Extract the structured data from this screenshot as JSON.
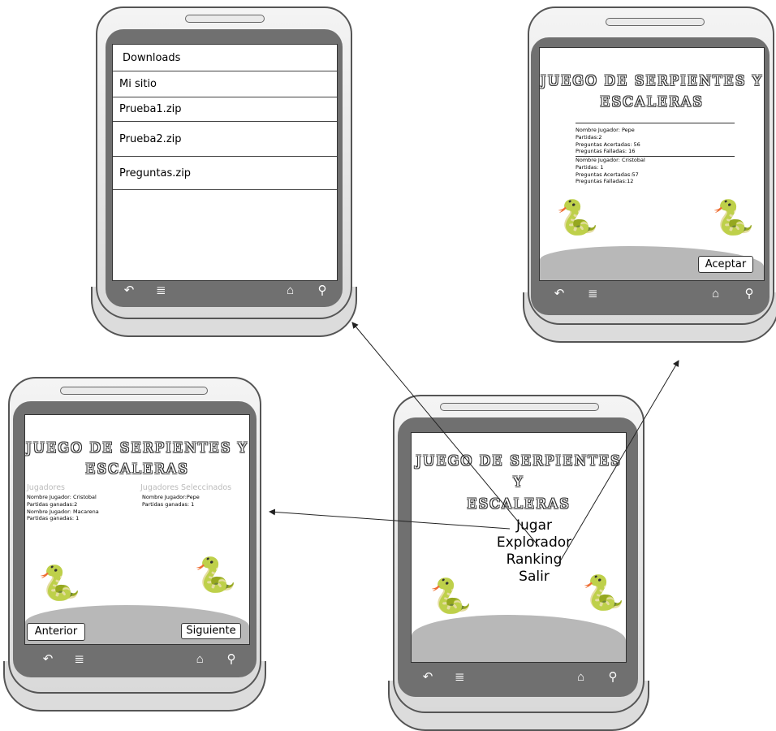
{
  "downloads_screen": {
    "header": "Downloads",
    "items": [
      "Mi sitio",
      "Prueba1.zip",
      "Prueba2.zip",
      "Preguntas.zip"
    ]
  },
  "ranking_screen": {
    "title_line1": "JUEGO DE SERPIENTES Y",
    "title_line2": "ESCALERAS",
    "players": [
      {
        "name": "Nombre Jugador: Pepe",
        "partidas": "Partidas:2",
        "acertadas": "Preguntas Acertadas: 56",
        "falladas": "Preguntas Falladas: 16"
      },
      {
        "name": "Nombre Jugador: Cristobal",
        "partidas": "Partidas: 1",
        "acertadas": "Preguntas Acertadas:57",
        "falladas": "Preguntas Falladas:12"
      }
    ],
    "accept_button": "Aceptar"
  },
  "players_screen": {
    "title_line1": "JUEGO DE SERPIENTES Y",
    "title_line2": "ESCALERAS",
    "col_left_title": "Jugadores",
    "col_right_title": "Jugadores Seleccinados",
    "left_lines": [
      "Nombre Jugador: Cristobal",
      "Partidas ganadas:2",
      "Nombre Jugador: Macarena",
      "Partidas ganadas: 1"
    ],
    "right_lines": [
      "Nombre Jugador:Pepe",
      "Partidas ganadas: 1"
    ],
    "prev_button": "Anterior",
    "next_button": "Siguiente"
  },
  "menu_screen": {
    "title_line1": "JUEGO DE SERPIENTES Y",
    "title_line2": "ESCALERAS",
    "menu_items": [
      "Jugar",
      "Explorador",
      "Ranking",
      "Salir"
    ]
  },
  "nav_icons": {
    "back": "↶",
    "menu": "≣",
    "home": "⌂",
    "search": "⚲"
  },
  "snake_glyph": "🐍"
}
